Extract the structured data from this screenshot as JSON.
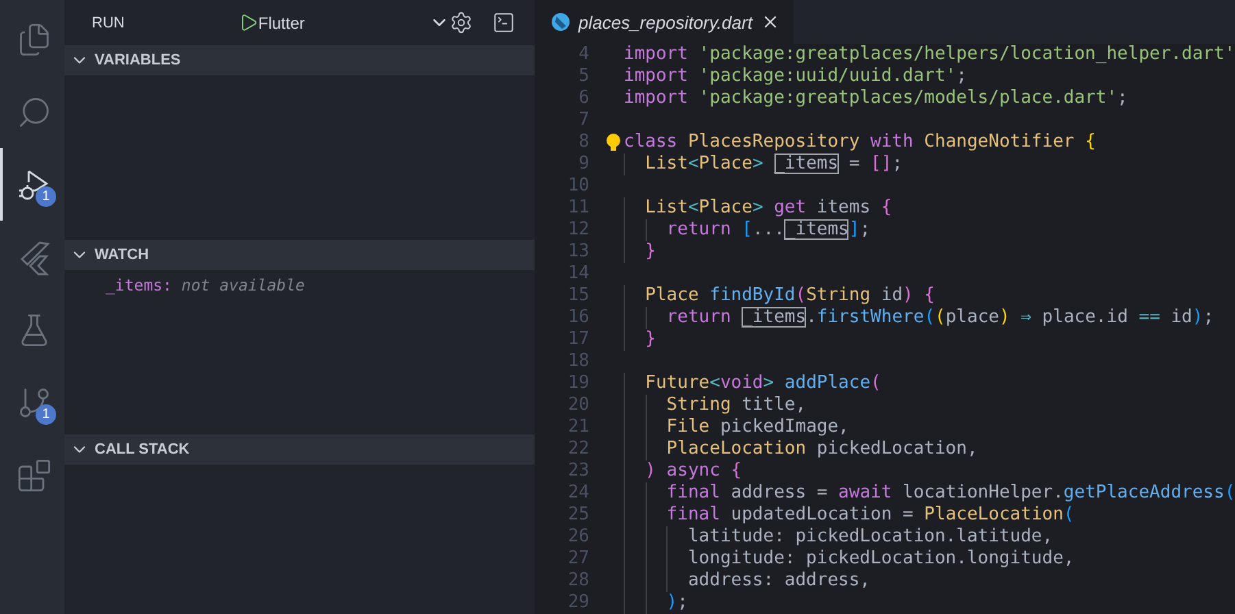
{
  "activity_bar": [
    {
      "kind": "explorer",
      "selected": false
    },
    {
      "kind": "search",
      "selected": false
    },
    {
      "kind": "debug",
      "selected": true,
      "badge": "1"
    },
    {
      "kind": "flutter",
      "selected": false
    },
    {
      "kind": "testing",
      "selected": false
    },
    {
      "kind": "source-control",
      "selected": false,
      "badge": "1"
    },
    {
      "kind": "extensions",
      "selected": false
    }
  ],
  "sidebar": {
    "title": "RUN",
    "configuration": "Flutter",
    "sections": [
      {
        "title": "VARIABLES",
        "expanded": true
      },
      {
        "title": "WATCH",
        "expanded": true,
        "items": [
          {
            "name": "_items:",
            "value": "not available"
          }
        ]
      },
      {
        "title": "CALL STACK",
        "expanded": true
      }
    ]
  },
  "tabs": [
    {
      "label": "places_repository.dart",
      "selected": true,
      "preview": true
    }
  ],
  "editor": {
    "lines": [
      {
        "number": "4",
        "tokens": [
          {
            "text": "import",
            "kind": "kw"
          },
          {
            "text": " 'package:greatplaces/helpers/location_helper.dart'",
            "kind": "str"
          }
        ]
      },
      {
        "number": "5",
        "tokens": [
          {
            "text": "import",
            "kind": "kw"
          },
          {
            "text": " 'package:uuid/uuid.dart'",
            "kind": "str"
          },
          {
            "text": ";",
            "kind": "plain"
          }
        ]
      },
      {
        "number": "6",
        "tokens": [
          {
            "text": "import",
            "kind": "kw"
          },
          {
            "text": " 'package:greatplaces/models/place.dart'",
            "kind": "str"
          },
          {
            "text": ";",
            "kind": "plain"
          }
        ]
      },
      {
        "number": "7"
      },
      {
        "number": "8",
        "lightbulb": true,
        "tokens": [
          {
            "text": "class",
            "kind": "kw"
          },
          {
            "text": " PlacesRepository",
            "kind": "type"
          },
          {
            "text": " with",
            "kind": "kw"
          },
          {
            "text": " ChangeNotifier",
            "kind": "type"
          },
          {
            "text": " {",
            "kind": "b1"
          }
        ]
      },
      {
        "number": "9",
        "tokens": [
          {
            "text": "  List",
            "kind": "type"
          },
          {
            "text": "<",
            "kind": "op"
          },
          {
            "text": "Place",
            "kind": "type"
          },
          {
            "text": ">",
            "kind": "op"
          },
          {
            "text": " _items",
            "kind": "match"
          },
          {
            "text": " = ",
            "kind": "plain"
          },
          {
            "text": "[]",
            "kind": "b2"
          },
          {
            "text": ";",
            "kind": "plain"
          }
        ]
      },
      {
        "number": "10"
      },
      {
        "number": "11",
        "tokens": [
          {
            "text": "  List",
            "kind": "type"
          },
          {
            "text": "<",
            "kind": "op"
          },
          {
            "text": "Place",
            "kind": "type"
          },
          {
            "text": ">",
            "kind": "op"
          },
          {
            "text": " get",
            "kind": "kw"
          },
          {
            "text": " items",
            "kind": "plain"
          },
          {
            "text": " {",
            "kind": "b2"
          }
        ]
      },
      {
        "number": "12",
        "tokens": [
          {
            "text": "    return",
            "kind": "kw"
          },
          {
            "text": " [",
            "kind": "b3"
          },
          {
            "text": "...",
            "kind": "plain"
          },
          {
            "text": "_items",
            "kind": "match"
          },
          {
            "text": "]",
            "kind": "b3"
          },
          {
            "text": ";",
            "kind": "plain"
          }
        ]
      },
      {
        "number": "13",
        "tokens": [
          {
            "text": "  }",
            "kind": "b2"
          }
        ]
      },
      {
        "number": "14"
      },
      {
        "number": "15",
        "tokens": [
          {
            "text": "  Place",
            "kind": "type"
          },
          {
            "text": " findById",
            "kind": "fn"
          },
          {
            "text": "(",
            "kind": "b2"
          },
          {
            "text": "String",
            "kind": "type"
          },
          {
            "text": " id",
            "kind": "plain"
          },
          {
            "text": ")",
            "kind": "b2"
          },
          {
            "text": " {",
            "kind": "b2"
          }
        ]
      },
      {
        "number": "16",
        "tokens": [
          {
            "text": "    return",
            "kind": "kw"
          },
          {
            "text": " _items",
            "kind": "match"
          },
          {
            "text": ".",
            "kind": "plain"
          },
          {
            "text": "firstWhere",
            "kind": "fn"
          },
          {
            "text": "(",
            "kind": "b3"
          },
          {
            "text": "(",
            "kind": "b1"
          },
          {
            "text": "place",
            "kind": "plain"
          },
          {
            "text": ")",
            "kind": "b1"
          },
          {
            "text": " ⇒ ",
            "kind": "op"
          },
          {
            "text": "place.id ",
            "kind": "plain"
          },
          {
            "text": "==",
            "kind": "op"
          },
          {
            "text": " id",
            "kind": "plain"
          },
          {
            "text": ")",
            "kind": "b3"
          },
          {
            "text": ";",
            "kind": "plain"
          }
        ]
      },
      {
        "number": "17",
        "tokens": [
          {
            "text": "  }",
            "kind": "b2"
          }
        ]
      },
      {
        "number": "18"
      },
      {
        "number": "19",
        "tokens": [
          {
            "text": "  Future",
            "kind": "type"
          },
          {
            "text": "<",
            "kind": "op"
          },
          {
            "text": "void",
            "kind": "kw"
          },
          {
            "text": ">",
            "kind": "op"
          },
          {
            "text": " addPlace",
            "kind": "fn"
          },
          {
            "text": "(",
            "kind": "b2"
          }
        ]
      },
      {
        "number": "20",
        "tokens": [
          {
            "text": "    String",
            "kind": "type"
          },
          {
            "text": " title,",
            "kind": "plain"
          }
        ]
      },
      {
        "number": "21",
        "tokens": [
          {
            "text": "    File",
            "kind": "type"
          },
          {
            "text": " pickedImage,",
            "kind": "plain"
          }
        ]
      },
      {
        "number": "22",
        "tokens": [
          {
            "text": "    PlaceLocation",
            "kind": "type"
          },
          {
            "text": " pickedLocation,",
            "kind": "plain"
          }
        ]
      },
      {
        "number": "23",
        "tokens": [
          {
            "text": "  )",
            "kind": "b2"
          },
          {
            "text": " async",
            "kind": "kw"
          },
          {
            "text": " {",
            "kind": "b2"
          }
        ]
      },
      {
        "number": "24",
        "tokens": [
          {
            "text": "    final",
            "kind": "kw"
          },
          {
            "text": " address = ",
            "kind": "plain"
          },
          {
            "text": "await",
            "kind": "kw"
          },
          {
            "text": " locationHelper.",
            "kind": "plain"
          },
          {
            "text": "getPlaceAddress",
            "kind": "fn"
          },
          {
            "text": "(",
            "kind": "b3"
          }
        ]
      },
      {
        "number": "25",
        "tokens": [
          {
            "text": "    final",
            "kind": "kw"
          },
          {
            "text": " updatedLocation = ",
            "kind": "plain"
          },
          {
            "text": "PlaceLocation",
            "kind": "type"
          },
          {
            "text": "(",
            "kind": "b3"
          }
        ]
      },
      {
        "number": "26",
        "tokens": [
          {
            "text": "      latitude: pickedLocation.latitude,",
            "kind": "plain"
          }
        ]
      },
      {
        "number": "27",
        "tokens": [
          {
            "text": "      longitude: pickedLocation.longitude,",
            "kind": "plain"
          }
        ]
      },
      {
        "number": "28",
        "tokens": [
          {
            "text": "      address: address,",
            "kind": "plain"
          }
        ]
      },
      {
        "number": "29",
        "tokens": [
          {
            "text": "    )",
            "kind": "b3"
          },
          {
            "text": ";",
            "kind": "plain"
          }
        ]
      }
    ]
  }
}
